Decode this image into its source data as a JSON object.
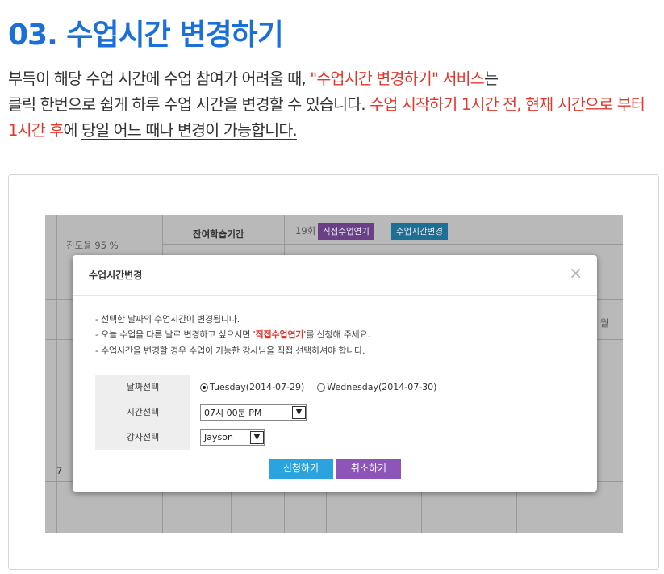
{
  "header": {
    "title": "03. 수업시간 변경하기"
  },
  "description": {
    "p1": "부득이 해당 수업 시간에 수업 참여가 어려울 때, ",
    "p2_red": "\"수업시간 변경하기\" 서비스",
    "p3": "는",
    "p4": "클릭 한번으로 쉽게 하루 수업 시간을 변경할 수 있습니다. ",
    "p5_red": "수업 시작하기 1시간 전, 현재 시간으로 부터 1시간 후",
    "p6": "에 ",
    "p7_underline": "당일 어느 때나 변경이 가능합니다."
  },
  "background": {
    "progress": "진도율 95 %",
    "remaining_label": "잔여학습기간",
    "remaining_value": "19회",
    "postpone_button": "직접수업연기",
    "change_button": "수업시간변경",
    "month_suffix": "월",
    "row_number": "7"
  },
  "modal": {
    "title": "수업시간변경",
    "close": "×",
    "notices": {
      "n1": "- 선택한 날짜의 수업시간이 변경됩니다.",
      "n2a": "- 오늘 수업을 다른 날로 변경하고 싶으시면 ",
      "n2b": "'직접수업연기'",
      "n2c": "를 신청해 주세요.",
      "n3": "- 수업시간을 변경할 경우 수업이 가능한 강사님을 직접 선택하셔야 합니다."
    },
    "form": {
      "date_label": "날짜선택",
      "date_option1": "Tuesday(2014-07-29)",
      "date_option2": "Wednesday(2014-07-30)",
      "date_selected": "Tuesday(2014-07-29)",
      "time_label": "시간선택",
      "time_value": "07시 00분 PM",
      "teacher_label": "강사선택",
      "teacher_value": "Jayson"
    },
    "buttons": {
      "apply": "신청하기",
      "cancel": "취소하기"
    }
  },
  "colors": {
    "title_blue": "#1b6fd8",
    "highlight_red": "#e8352b",
    "apply_blue": "#2aa3df",
    "cancel_purple": "#8e55b8"
  }
}
